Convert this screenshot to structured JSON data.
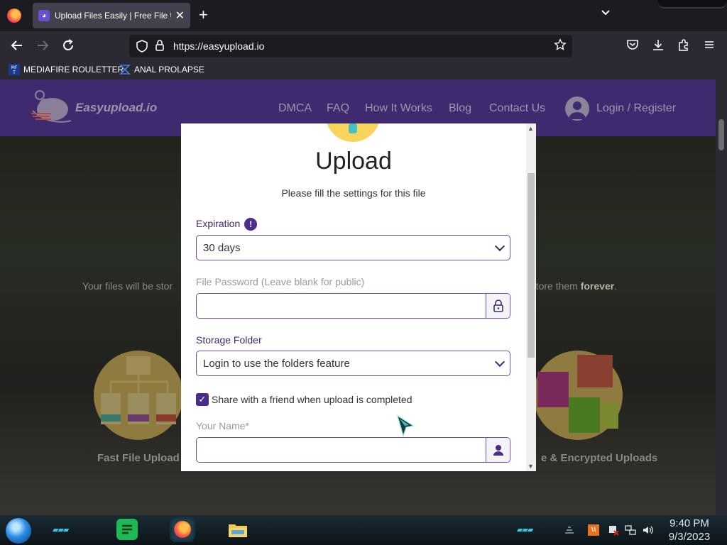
{
  "browser": {
    "tab_title": "Upload Files Easily | Free File Up",
    "tab_close": "✕",
    "new_tab": "+",
    "tab_list": "⌄",
    "url": "https://easyupload.io",
    "bookmarks": [
      {
        "label": "MEDIAFIRE ROULETTER",
        "icon": "mf-icon"
      },
      {
        "label": "ANAL PROLAPSE",
        "icon": "bookmark-glyph-icon"
      }
    ]
  },
  "site": {
    "brand": "Easyupload.io",
    "nav": [
      "DMCA",
      "FAQ",
      "How It Works",
      "Blog",
      "Contact Us"
    ],
    "login": "Login / Register",
    "hero_left": "Your files will be stor",
    "hero_right_prefix": "d store them ",
    "hero_right_bold": "forever",
    "hero_right_suffix": ".",
    "feature_left": "Fast File Upload",
    "feature_right": "e & Encrypted Uploads"
  },
  "modal": {
    "title": "Upload",
    "subtitle": "Please fill the settings for this file",
    "expiration_label": "Expiration",
    "info_glyph": "!",
    "expiration_value": "30 days",
    "password_label": "File Password (Leave blank for public)",
    "password_value": "",
    "storage_label": "Storage Folder",
    "storage_value": "Login to use the folders feature",
    "share_label": "Share with a friend when upload is completed",
    "share_checked": true,
    "check_glyph": "✓",
    "your_name_label": "Your Name*",
    "your_name_value": ""
  },
  "taskbar": {
    "time": "9:40 PM",
    "date": "9/3/2023"
  },
  "colors": {
    "header_purple": "#3f2a70",
    "accent_purple": "#4a2c8a",
    "field_border": "#6a4fb0",
    "browser_dark": "#1c1b22",
    "toolbar": "#2b2a33"
  }
}
